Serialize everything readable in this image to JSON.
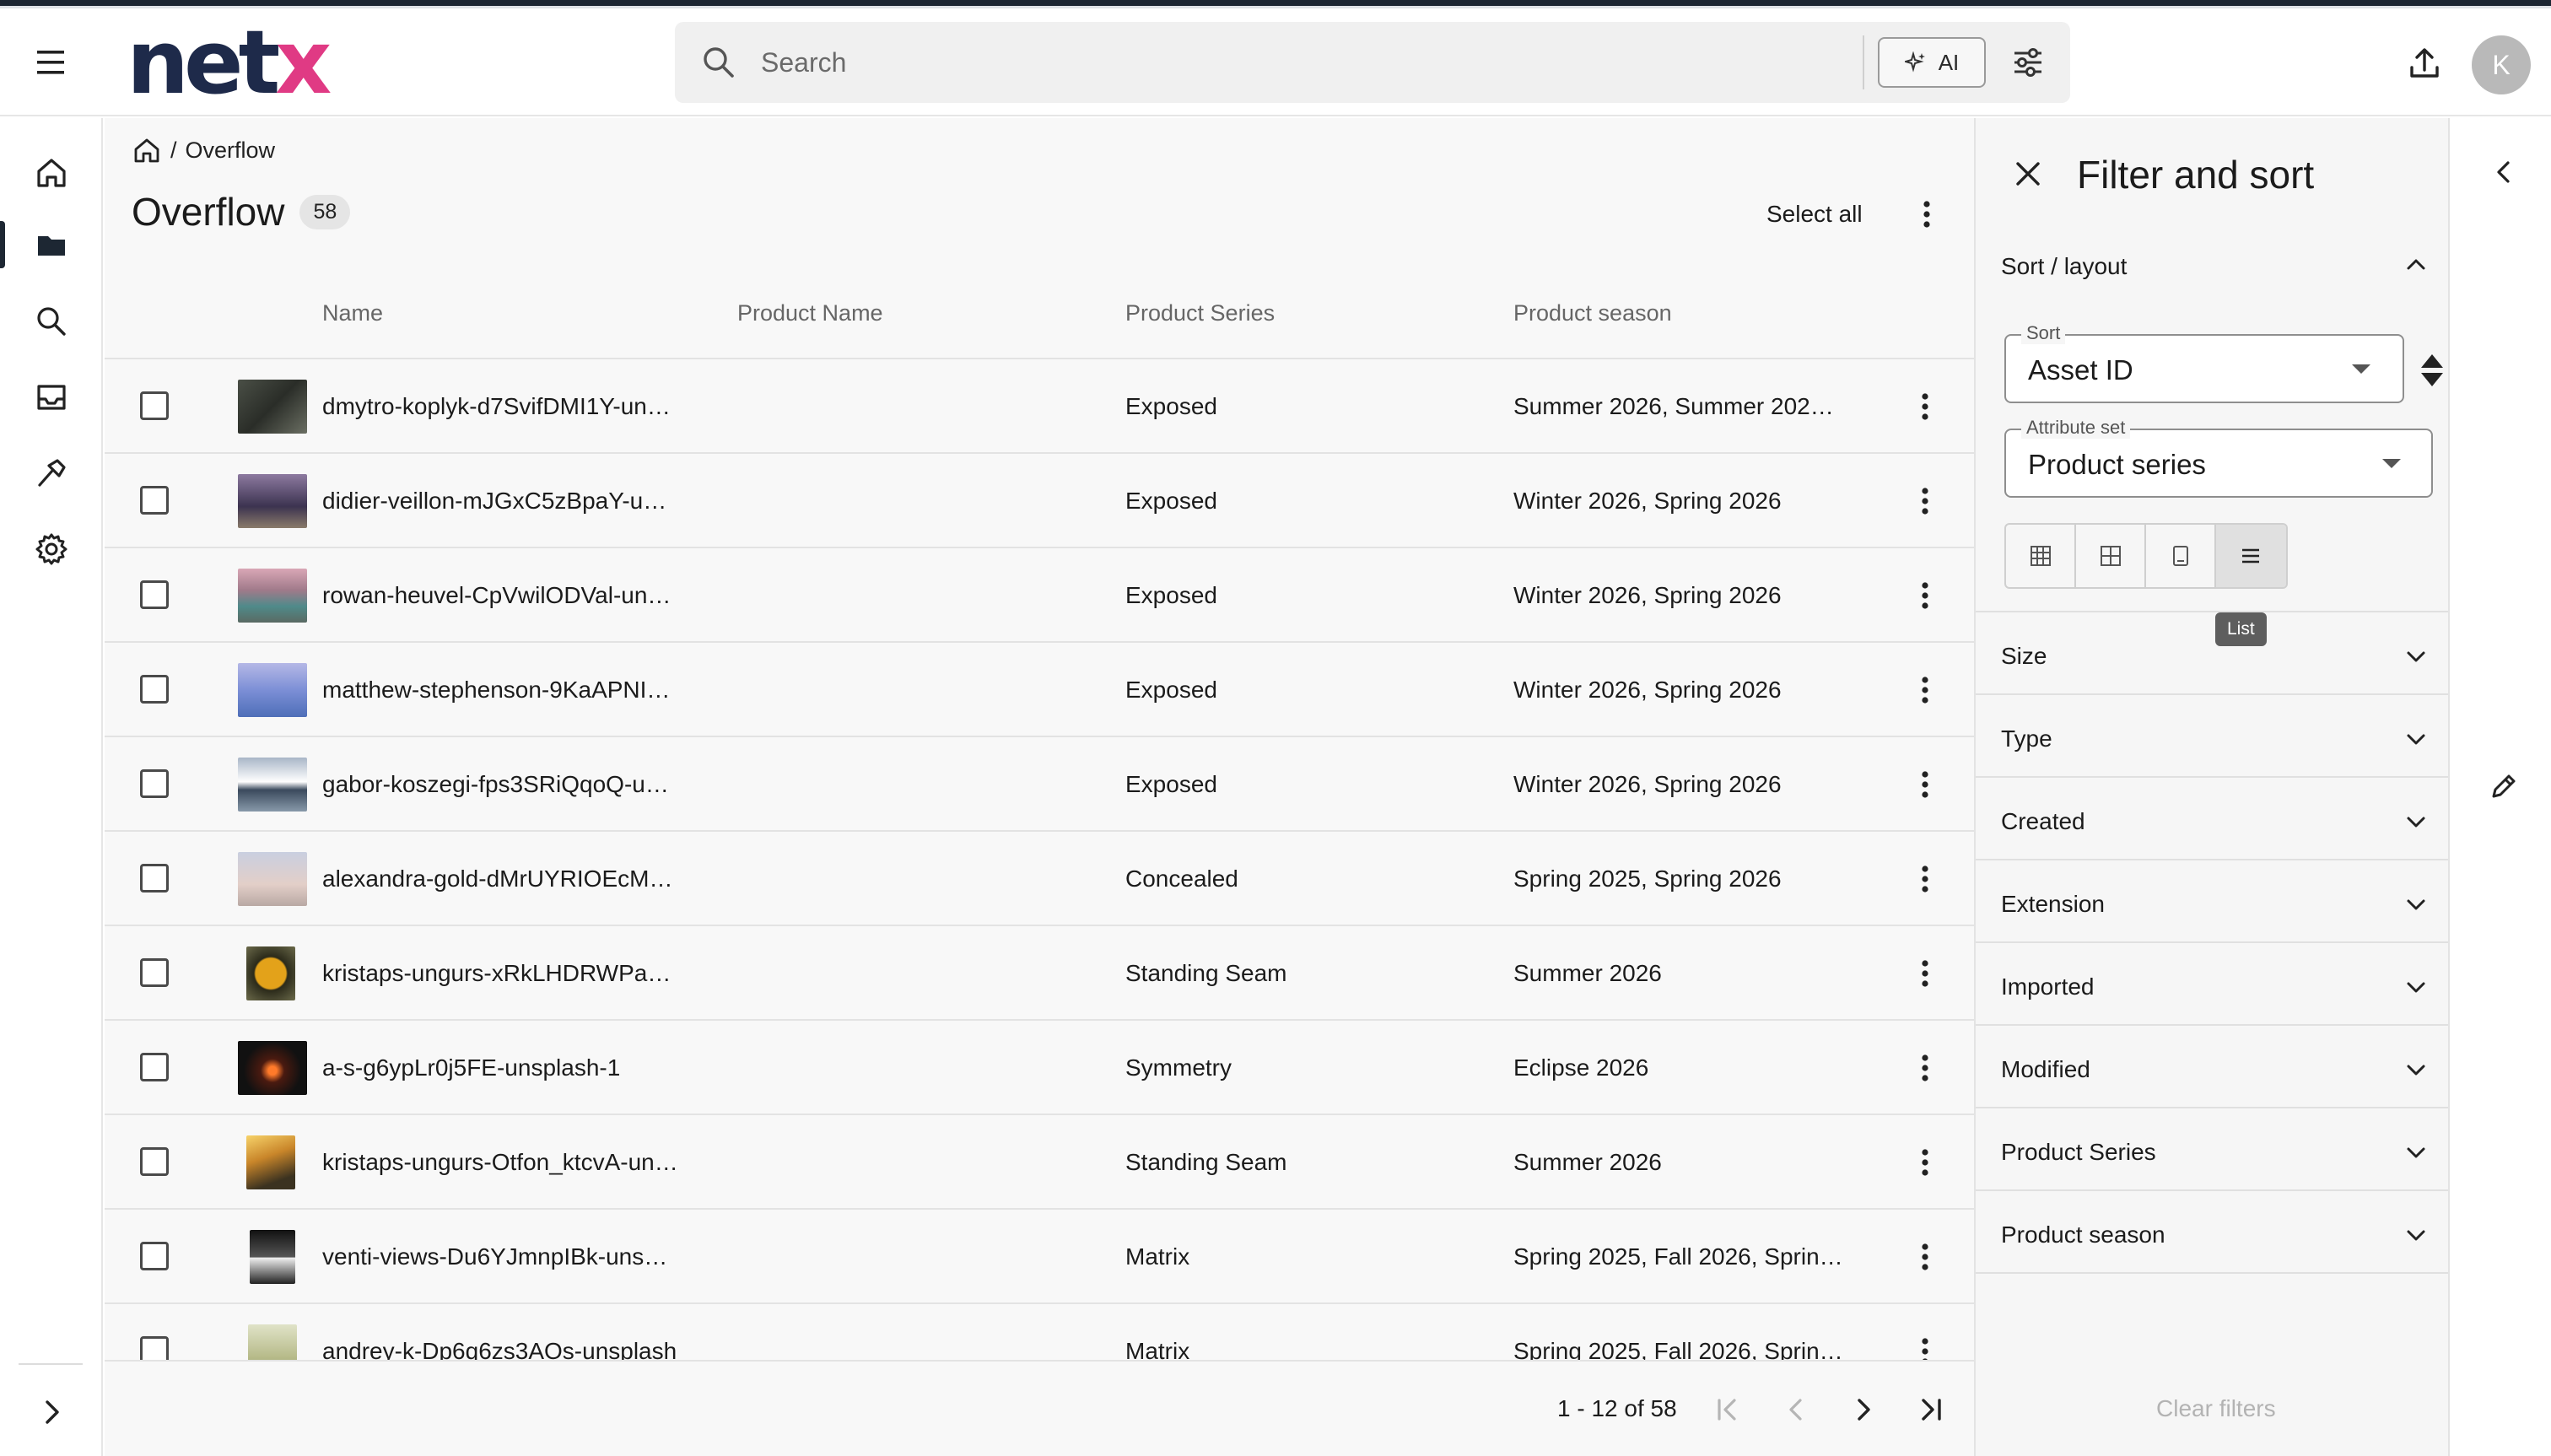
{
  "app": {
    "logo_main": "net",
    "logo_accent": "x",
    "user_initial": "K"
  },
  "colors": {
    "brand_navy": "#1e2a4a",
    "brand_pink": "#e03a84",
    "active_rail": "#1d2733"
  },
  "header": {
    "search_placeholder": "Search",
    "ai_label": "AI",
    "icons": [
      "menu-icon",
      "search-icon",
      "sparkle-icon",
      "sliders-icon",
      "upload-icon"
    ]
  },
  "rail": {
    "items": [
      "home-icon",
      "folder-icon",
      "search-icon",
      "inbox-icon",
      "hammer-icon",
      "gear-icon"
    ],
    "active": "folder-icon"
  },
  "breadcrumb": {
    "separator": "/",
    "current": "Overflow"
  },
  "page": {
    "title": "Overflow",
    "count": "58",
    "select_all": "Select all"
  },
  "table": {
    "columns": [
      "Name",
      "Product Name",
      "Product Series",
      "Product season"
    ],
    "rows": [
      {
        "name": "dmytro-koplyk-d7SvifDMI1Y-un…",
        "product_name": "",
        "series": "Exposed",
        "season": "Summer 2026, Summer 202…",
        "thumb": "linear-gradient(135deg,#4a4f46,#2a2d28 50%,#6b6f63)"
      },
      {
        "name": "didier-veillon-mJGxC5zBpaY-u…",
        "product_name": "",
        "series": "Exposed",
        "season": "Winter 2026, Spring 2026",
        "thumb": "linear-gradient(180deg,#8d7aa0,#3c3350 60%,#8a7b6a)"
      },
      {
        "name": "rowan-heuvel-CpVwilODVal-un…",
        "product_name": "",
        "series": "Exposed",
        "season": "Winter 2026, Spring 2026",
        "thumb": "linear-gradient(180deg,#d9a7b6,#a07a8a 40%,#4f8a8a 70%,#5a6a63)"
      },
      {
        "name": "matthew-stephenson-9KaAPNI…",
        "product_name": "",
        "series": "Exposed",
        "season": "Winter 2026, Spring 2026",
        "thumb": "linear-gradient(180deg,#b5b8e6,#7c8fd6 50%,#4e6fb8)"
      },
      {
        "name": "gabor-koszegi-fps3SRiQqoQ-u…",
        "product_name": "",
        "series": "Exposed",
        "season": "Winter 2026, Spring 2026",
        "thumb": "linear-gradient(180deg,#a9b6c7,#ffffff 45%,#3b4a5d 60%,#8899aa)"
      },
      {
        "name": "alexandra-gold-dMrUYRIOEcM…",
        "product_name": "",
        "series": "Concealed",
        "season": "Spring 2025, Spring 2026",
        "thumb": "linear-gradient(180deg,#c9cfe0,#e3cfc8 60%,#b9a9a4)"
      },
      {
        "name": "kristaps-ungurs-xRkLHDRWPa…",
        "product_name": "",
        "series": "Standing Seam",
        "season": "Summer 2026",
        "thumb": "radial-gradient(circle at 50% 50%,#e3a21a 0 18px,#2b2a1a 20px,#6b6a4a)"
      },
      {
        "name": "a-s-g6ypLr0j5FE-unsplash-1",
        "product_name": "",
        "series": "Symmetry",
        "season": "Eclipse 2026",
        "thumb": "radial-gradient(circle at 50% 55%,#ff7a2a 0 5px,#4a1a10 14px,#111111 34px)"
      },
      {
        "name": "kristaps-ungurs-Otfon_ktcvA-un…",
        "product_name": "",
        "series": "Standing Seam",
        "season": "Summer 2026",
        "thumb": "linear-gradient(160deg,#f7d36a,#c9862a 40%,#3b3220 80%)"
      },
      {
        "name": "venti-views-Du6YJmnpIBk-uns…",
        "product_name": "",
        "series": "Matrix",
        "season": "Spring 2025, Fall 2026, Sprin…",
        "thumb": "linear-gradient(180deg,#111,#555 50%,#eee 52%,#222)"
      },
      {
        "name": "andrey-k-Dp6q6zs3AOs-unsplash",
        "product_name": "",
        "series": "Matrix",
        "season": "Spring 2025, Fall 2026, Sprin…",
        "thumb": "linear-gradient(180deg,#e0e3c8,#b7bb8a 60%,#8f9a6a)"
      }
    ]
  },
  "pagination": {
    "range": "1 - 12 of 58"
  },
  "panel": {
    "title": "Filter and sort",
    "sort_layout_label": "Sort / layout",
    "sort_label": "Sort",
    "sort_value": "Asset ID",
    "attribute_set_label": "Attribute set",
    "attribute_set_value": "Product series",
    "layout_options": [
      "table-grid-icon",
      "grid-icon",
      "tile-icon",
      "list-icon"
    ],
    "layout_active": "list-icon",
    "tooltip": "List",
    "sections": [
      "Size",
      "Type",
      "Created",
      "Extension",
      "Imported",
      "Modified",
      "Product Series",
      "Product season"
    ],
    "clear_filters": "Clear filters"
  }
}
